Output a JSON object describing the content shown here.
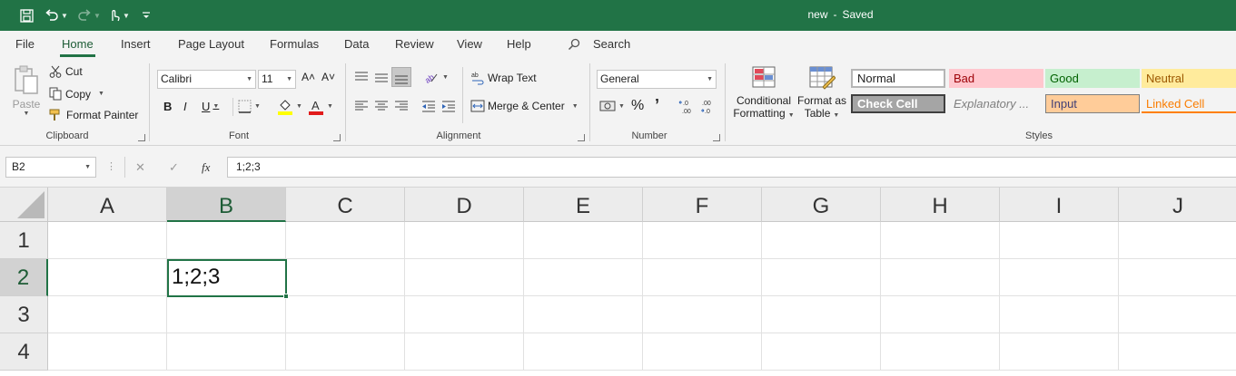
{
  "title": {
    "document": "new",
    "separator": "-",
    "status": "Saved"
  },
  "tabs": [
    "File",
    "Home",
    "Insert",
    "Page Layout",
    "Formulas",
    "Data",
    "Review",
    "View",
    "Help"
  ],
  "active_tab": "Home",
  "search_label": "Search",
  "clipboard": {
    "paste": "Paste",
    "cut": "Cut",
    "copy": "Copy",
    "format_painter": "Format Painter",
    "label": "Clipboard"
  },
  "font": {
    "name": "Calibri",
    "size": "11",
    "bold": "B",
    "italic": "I",
    "underline": "U",
    "grow": "A˄",
    "shrink": "A˅",
    "fill_letter": "◇",
    "font_color_letter": "A",
    "label": "Font"
  },
  "alignment": {
    "wrap_text": "Wrap Text",
    "merge_center": "Merge & Center",
    "label": "Alignment"
  },
  "number": {
    "format": "General",
    "percent": "%",
    "comma": "’",
    "inc_decimal": "←.0 .00",
    "dec_decimal": ".00 →.0",
    "label": "Number"
  },
  "styles_cmds": {
    "conditional_1": "Conditional",
    "conditional_2": "Formatting",
    "format_table_1": "Format as",
    "format_table_2": "Table",
    "label": "Styles"
  },
  "style_gallery": [
    {
      "name": "Normal",
      "bg": "#ffffff",
      "color": "#222222"
    },
    {
      "name": "Bad",
      "bg": "#ffc7ce",
      "color": "#9c0006"
    },
    {
      "name": "Good",
      "bg": "#c6efce",
      "color": "#006100"
    },
    {
      "name": "Neutral",
      "bg": "#ffeb9c",
      "color": "#9c5700"
    },
    {
      "name": "Check Cell",
      "bg": "#a5a5a5",
      "color": "#ffffff"
    },
    {
      "name": "Explanatory ...",
      "bg": "#f3f3f3",
      "color": "#7f7f7f"
    },
    {
      "name": "Input",
      "bg": "#ffcc99",
      "color": "#3f3f76"
    },
    {
      "name": "Linked Cell",
      "bg": "#f3f3f3",
      "color": "#fa7d00"
    }
  ],
  "formula_bar": {
    "name_box": "B2",
    "cancel": "✕",
    "enter": "✓",
    "fx": "fx",
    "content": "1;2;3"
  },
  "grid": {
    "columns": [
      "A",
      "B",
      "C",
      "D",
      "E",
      "F",
      "G",
      "H",
      "I",
      "J"
    ],
    "rows": [
      "1",
      "2",
      "3",
      "4"
    ],
    "selected_column": "B",
    "selected_row": "2",
    "cells": {
      "B2": "1;2;3"
    }
  },
  "colors": {
    "accent": "#217346",
    "ribbon_bg": "#f3f3f3",
    "header_bg": "#ececec"
  }
}
